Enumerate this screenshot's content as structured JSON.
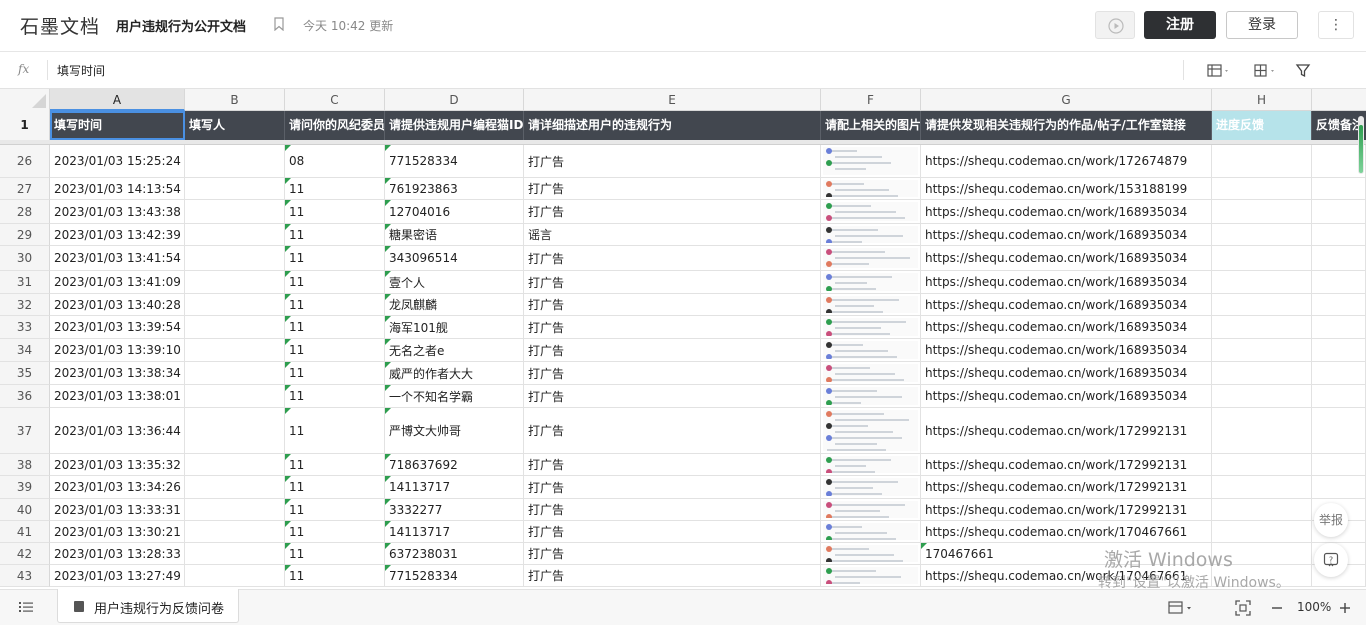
{
  "app": {
    "logo": "石墨文档",
    "doc_title": "用户违规行为公开文档",
    "update_time": "今天 10:42 更新",
    "register_label": "注册",
    "login_label": "登录",
    "more_label": "⋮"
  },
  "formula_bar": {
    "fx_label": "fx",
    "value": "填写时间"
  },
  "columns": [
    "A",
    "B",
    "C",
    "D",
    "E",
    "F",
    "G",
    "H"
  ],
  "header_row_number": "1",
  "headers": [
    "填写时间",
    "填写人",
    "请问你的风纪委员",
    "请提供违规用户编程猫ID",
    "请详细描述用户的违规行为",
    "请配上相关的图片",
    "请提供发现相关违规行为的作品/帖子/工作室链接",
    "进度反馈",
    "反馈备注"
  ],
  "rows": [
    {
      "num": "26",
      "time": "2023/01/03 15:25:24",
      "b": "",
      "c": "08",
      "d": "771528334",
      "e": "打广告",
      "g": "https://shequ.codemao.cn/work/172674879"
    },
    {
      "num": "27",
      "time": "2023/01/03 14:13:54",
      "b": "",
      "c": "11",
      "d": "761923863",
      "e": "打广告",
      "g": "https://shequ.codemao.cn/work/153188199"
    },
    {
      "num": "28",
      "time": "2023/01/03 13:43:38",
      "b": "",
      "c": "11",
      "d": "12704016",
      "e": "打广告",
      "g": "https://shequ.codemao.cn/work/168935034"
    },
    {
      "num": "29",
      "time": "2023/01/03 13:42:39",
      "b": "",
      "c": "11",
      "d": "糖果密语",
      "e": "谣言",
      "g": "https://shequ.codemao.cn/work/168935034"
    },
    {
      "num": "30",
      "time": "2023/01/03 13:41:54",
      "b": "",
      "c": "11",
      "d": "343096514",
      "e": "打广告",
      "g": "https://shequ.codemao.cn/work/168935034"
    },
    {
      "num": "31",
      "time": "2023/01/03 13:41:09",
      "b": "",
      "c": "11",
      "d": "壹个人",
      "e": "打广告",
      "g": "https://shequ.codemao.cn/work/168935034"
    },
    {
      "num": "32",
      "time": "2023/01/03 13:40:28",
      "b": "",
      "c": "11",
      "d": "龙凤麒麟",
      "e": "打广告",
      "g": "https://shequ.codemao.cn/work/168935034"
    },
    {
      "num": "33",
      "time": "2023/01/03 13:39:54",
      "b": "",
      "c": "11",
      "d": "海军101舰",
      "e": "打广告",
      "g": "https://shequ.codemao.cn/work/168935034"
    },
    {
      "num": "34",
      "time": "2023/01/03 13:39:10",
      "b": "",
      "c": "11",
      "d": "无名之者e",
      "e": "打广告",
      "g": "https://shequ.codemao.cn/work/168935034"
    },
    {
      "num": "35",
      "time": "2023/01/03 13:38:34",
      "b": "",
      "c": "11",
      "d": "威严的作者大大",
      "e": "打广告",
      "g": "https://shequ.codemao.cn/work/168935034"
    },
    {
      "num": "36",
      "time": "2023/01/03 13:38:01",
      "b": "",
      "c": "11",
      "d": "一个不知名学霸",
      "e": "打广告",
      "g": "https://shequ.codemao.cn/work/168935034"
    },
    {
      "num": "37",
      "time": "2023/01/03 13:36:44",
      "b": "",
      "c": "11",
      "d": "严博文大帅哥",
      "e": "打广告",
      "g": "https://shequ.codemao.cn/work/172992131"
    },
    {
      "num": "38",
      "time": "2023/01/03 13:35:32",
      "b": "",
      "c": "11",
      "d": "718637692",
      "e": "打广告",
      "g": "https://shequ.codemao.cn/work/172992131"
    },
    {
      "num": "39",
      "time": "2023/01/03 13:34:26",
      "b": "",
      "c": "11",
      "d": "14113717",
      "e": "打广告",
      "g": "https://shequ.codemao.cn/work/172992131"
    },
    {
      "num": "40",
      "time": "2023/01/03 13:33:31",
      "b": "",
      "c": "11",
      "d": "3332277",
      "e": "打广告",
      "g": "https://shequ.codemao.cn/work/172992131"
    },
    {
      "num": "41",
      "time": "2023/01/03 13:30:21",
      "b": "",
      "c": "11",
      "d": "14113717",
      "e": "打广告",
      "g": "https://shequ.codemao.cn/work/170467661"
    },
    {
      "num": "42",
      "time": "2023/01/03 13:28:33",
      "b": "",
      "c": "11",
      "d": "637238031",
      "e": "打广告",
      "g": "170467661"
    },
    {
      "num": "43",
      "time": "2023/01/03 13:27:49",
      "b": "",
      "c": "11",
      "d": "771528334",
      "e": "打广告",
      "g": "https://shequ.codemao.cn/work/170467661"
    }
  ],
  "floating": {
    "report_label": "举报",
    "help_label": "?"
  },
  "watermark": {
    "line1": "激活 Windows",
    "line2": "转到\"设置\"以激活 Windows。"
  },
  "bottom_bar": {
    "sheet_tab_label": "用户违规行为反馈问卷",
    "zoom": "100%"
  },
  "colors": {
    "header_bg": "#42474f",
    "accent_green": "#2e9e4f",
    "selection_blue": "#4a90e2"
  }
}
